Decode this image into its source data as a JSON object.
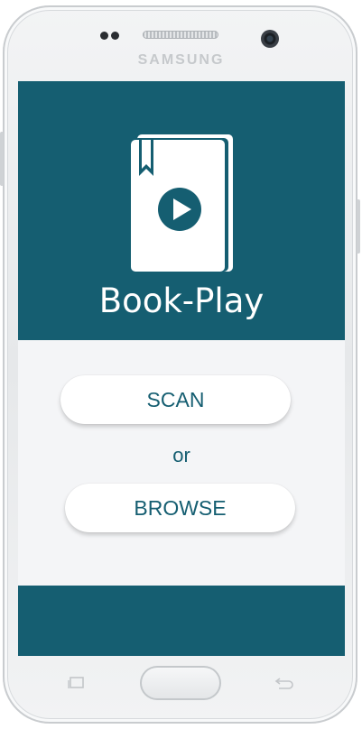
{
  "device": {
    "brand": "SAMSUNG"
  },
  "app": {
    "title": "Book-Play",
    "scan_label": "SCAN",
    "or_label": "or",
    "browse_label": "BROWSE"
  },
  "colors": {
    "primary": "#155e71",
    "background": "#f4f5f7",
    "button": "#ffffff"
  },
  "icons": {
    "logo": "book-play-icon",
    "recent": "recent-apps-icon",
    "back": "back-icon"
  }
}
